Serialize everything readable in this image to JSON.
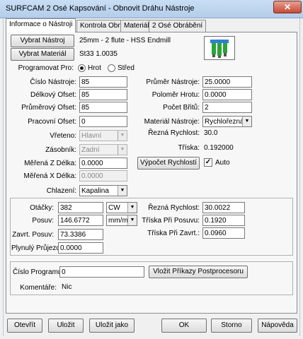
{
  "window": {
    "title": "SURFCAM 2 Osé Kapsování - Obnovit Dráhu Nástroje",
    "close_glyph": "✕"
  },
  "tabs": [
    {
      "label": "Informace o Nástroji",
      "active": true
    },
    {
      "label": "Kontrola Obrábění",
      "active": false
    },
    {
      "label": "Materiál",
      "active": false
    },
    {
      "label": "2 Osé Obrábění",
      "active": false
    }
  ],
  "tool": {
    "select_button": "Vybrat Nástroj",
    "description": "25mm - 2 flute - HSS Endmill",
    "material_button": "Vybrat Materiál",
    "material_value": "St33 1.0035"
  },
  "program_for": {
    "label": "Programovat Pro:",
    "option_tip": "Hrot",
    "option_center": "Střed",
    "selected": "Hrot"
  },
  "left_fields": {
    "tool_number": {
      "label": "Číslo Nástroje:",
      "value": "85"
    },
    "length_offset": {
      "label": "Délkový Ofset:",
      "value": "85"
    },
    "diameter_offset": {
      "label": "Průměrový Ofset:",
      "value": "85"
    },
    "work_offset": {
      "label": "Pracovní Ofset:",
      "value": "0"
    },
    "spindle": {
      "label": "Vřeteno:",
      "value": "Hlavní"
    },
    "magazine": {
      "label": "Zásobník:",
      "value": "Zadní"
    },
    "measured_z": {
      "label": "Měřená Z Délka:",
      "value": "0.0000"
    },
    "measured_x": {
      "label": "Měřená X Délka:",
      "value": "0.0000"
    },
    "coolant": {
      "label": "Chlazení:",
      "value": "Kapalina"
    }
  },
  "right_fields": {
    "tool_diameter": {
      "label": "Průměr Nástroje:",
      "value": "25.0000"
    },
    "tip_radius": {
      "label": "Poloměr Hrotu:",
      "value": "0.0000"
    },
    "flutes": {
      "label": "Počet Břitů:",
      "value": "2"
    },
    "tool_material": {
      "label": "Materiál Nástroje:",
      "value": "Rychlořezná o"
    },
    "cutting_speed": {
      "label": "Řezná Rychlost:",
      "value": "30.0"
    },
    "chip": {
      "label": "Tříska:",
      "value": "0.192000"
    },
    "calc_speed_button": "Výpočet Rychlostí",
    "auto_label": "Auto",
    "auto_checked": true
  },
  "feeds": {
    "rpm": {
      "label": "Otáčky:",
      "value": "382",
      "direction": "CW"
    },
    "feed": {
      "label": "Posuv:",
      "value": "146.6772",
      "unit": "mm/min"
    },
    "plunge": {
      "label": "Zavrt. Posuv:",
      "value": "73.3386"
    },
    "smooth": {
      "label": "Plynulý Průjezd:",
      "value": "0.0000"
    },
    "surface_speed": {
      "label": "Řezná Rychlost:",
      "value": "30.0022"
    },
    "chip_feed": {
      "label": "Tříska Při Posuvu:",
      "value": "0.1920"
    },
    "chip_plunge": {
      "label": "Tříska Při Zavrt.:",
      "value": "0.0960"
    }
  },
  "program": {
    "number_label": "Číslo Programu:",
    "number_value": "0",
    "insert_button": "Vložit Příkazy Postprocesoru",
    "comment_label": "Komentáře:",
    "comment_value": "Nic"
  },
  "footer": {
    "open": "Otevřít",
    "save": "Uložit",
    "save_as": "Uložit jako",
    "ok": "OK",
    "cancel": "Storno",
    "help": "Nápověda"
  },
  "colors": {
    "titlebar": "#c9def5",
    "close": "#c74a38"
  },
  "icons": {
    "window": "app-icon",
    "tool_preview": "tool-holder-icon",
    "dropdown": "chevron-down-icon"
  }
}
